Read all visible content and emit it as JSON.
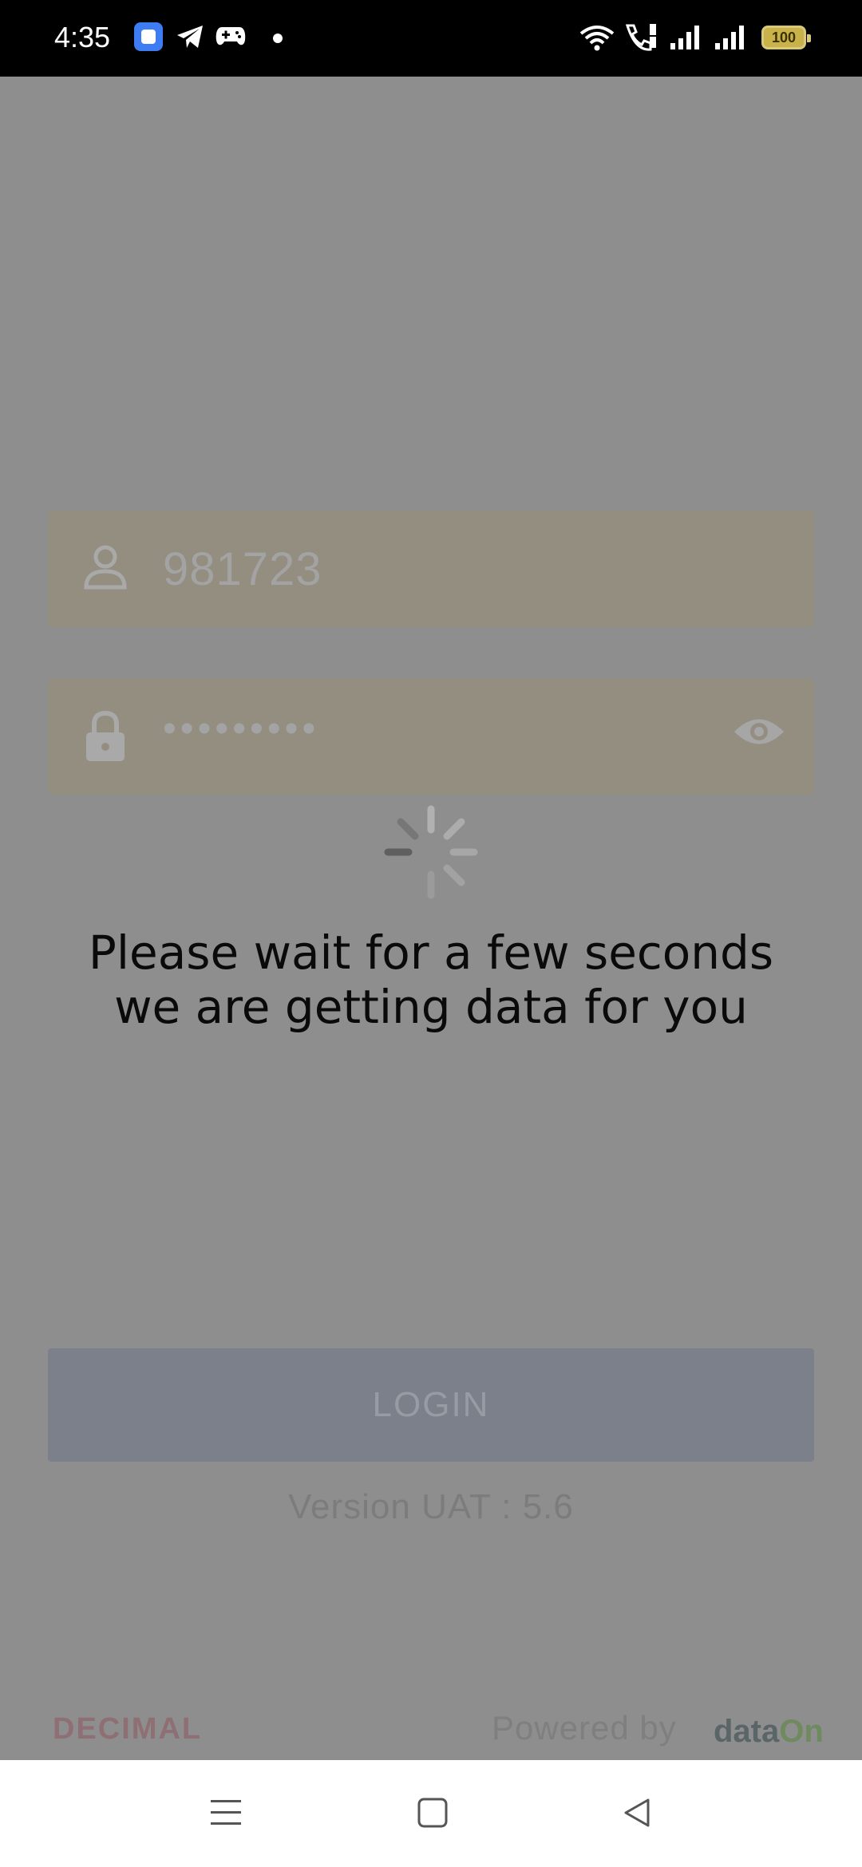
{
  "status_bar": {
    "time": "4:35",
    "battery": "100",
    "icons": [
      "app-icon",
      "telegram-icon",
      "game-controller-icon",
      "notification-dot",
      "wifi-icon",
      "wifi-calling-icon",
      "signal-icon",
      "signal-icon",
      "battery-icon"
    ]
  },
  "login_form": {
    "username": {
      "value": "981723",
      "icon": "user-icon"
    },
    "password": {
      "value": "•••••••••",
      "icon": "lock-icon",
      "toggle_icon": "eye-icon"
    }
  },
  "loader": {
    "icon": "spinner-icon",
    "message_line1": "Please wait for a few seconds",
    "message_line2": "we are getting data for you"
  },
  "login_button": {
    "label": "LOGIN"
  },
  "version": "Version UAT : 5.6",
  "footer": {
    "brand_left": "DECIMAL",
    "powered_by": "Powered by",
    "brand_right_part1": "data",
    "brand_right_part2": "On"
  },
  "nav_bar": {
    "buttons": [
      "menu-icon",
      "home-icon",
      "back-icon"
    ]
  },
  "colors": {
    "overlay": "#8e8e8e",
    "field_background": "#948e80",
    "button_background": "#7b808a",
    "text_dark": "#0a0a0a"
  }
}
